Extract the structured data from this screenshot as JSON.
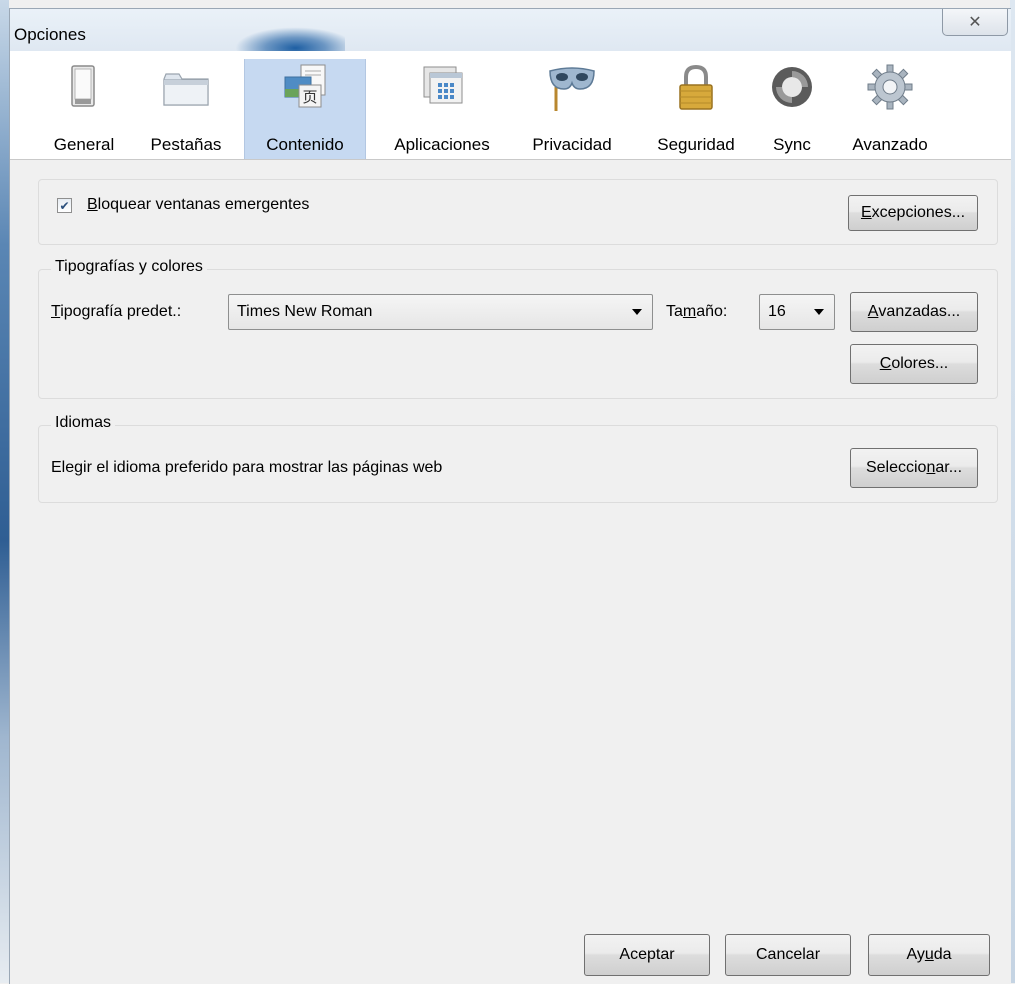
{
  "window": {
    "title": "Opciones",
    "close_glyph": "✕"
  },
  "tabs": [
    {
      "label": "General",
      "icon": "general-switch-icon"
    },
    {
      "label": "Pestañas",
      "icon": "tabs-folder-icon"
    },
    {
      "label": "Contenido",
      "icon": "content-page-icon",
      "selected": true
    },
    {
      "label": "Aplicaciones",
      "icon": "applications-window-icon"
    },
    {
      "label": "Privacidad",
      "icon": "privacy-mask-icon"
    },
    {
      "label": "Seguridad",
      "icon": "security-lock-icon"
    },
    {
      "label": "Sync",
      "icon": "sync-arrows-icon"
    },
    {
      "label": "Avanzado",
      "icon": "advanced-gear-icon"
    }
  ],
  "popups": {
    "checkbox_checked": true,
    "label_access": "B",
    "label_rest": "loquear ventanas emergentes",
    "exceptions_access": "E",
    "exceptions_rest": "xcepciones..."
  },
  "fonts": {
    "legend": "Tipografías y colores",
    "default_font_access": "T",
    "default_font_rest": "ipografía predet.:",
    "default_font_value": "Times New Roman",
    "size_pre": "Ta",
    "size_access": "m",
    "size_post": "año:",
    "size_value": "16",
    "advanced_access": "A",
    "advanced_rest": "vanzadas...",
    "colors_access": "C",
    "colors_rest": "olores..."
  },
  "languages": {
    "legend": "Idiomas",
    "description": "Elegir el idioma preferido para mostrar las páginas web",
    "select_pre": "Seleccio",
    "select_access": "n",
    "select_post": "ar..."
  },
  "footer": {
    "accept": "Aceptar",
    "cancel": "Cancelar",
    "help_pre": "Ay",
    "help_access": "u",
    "help_post": "da"
  }
}
